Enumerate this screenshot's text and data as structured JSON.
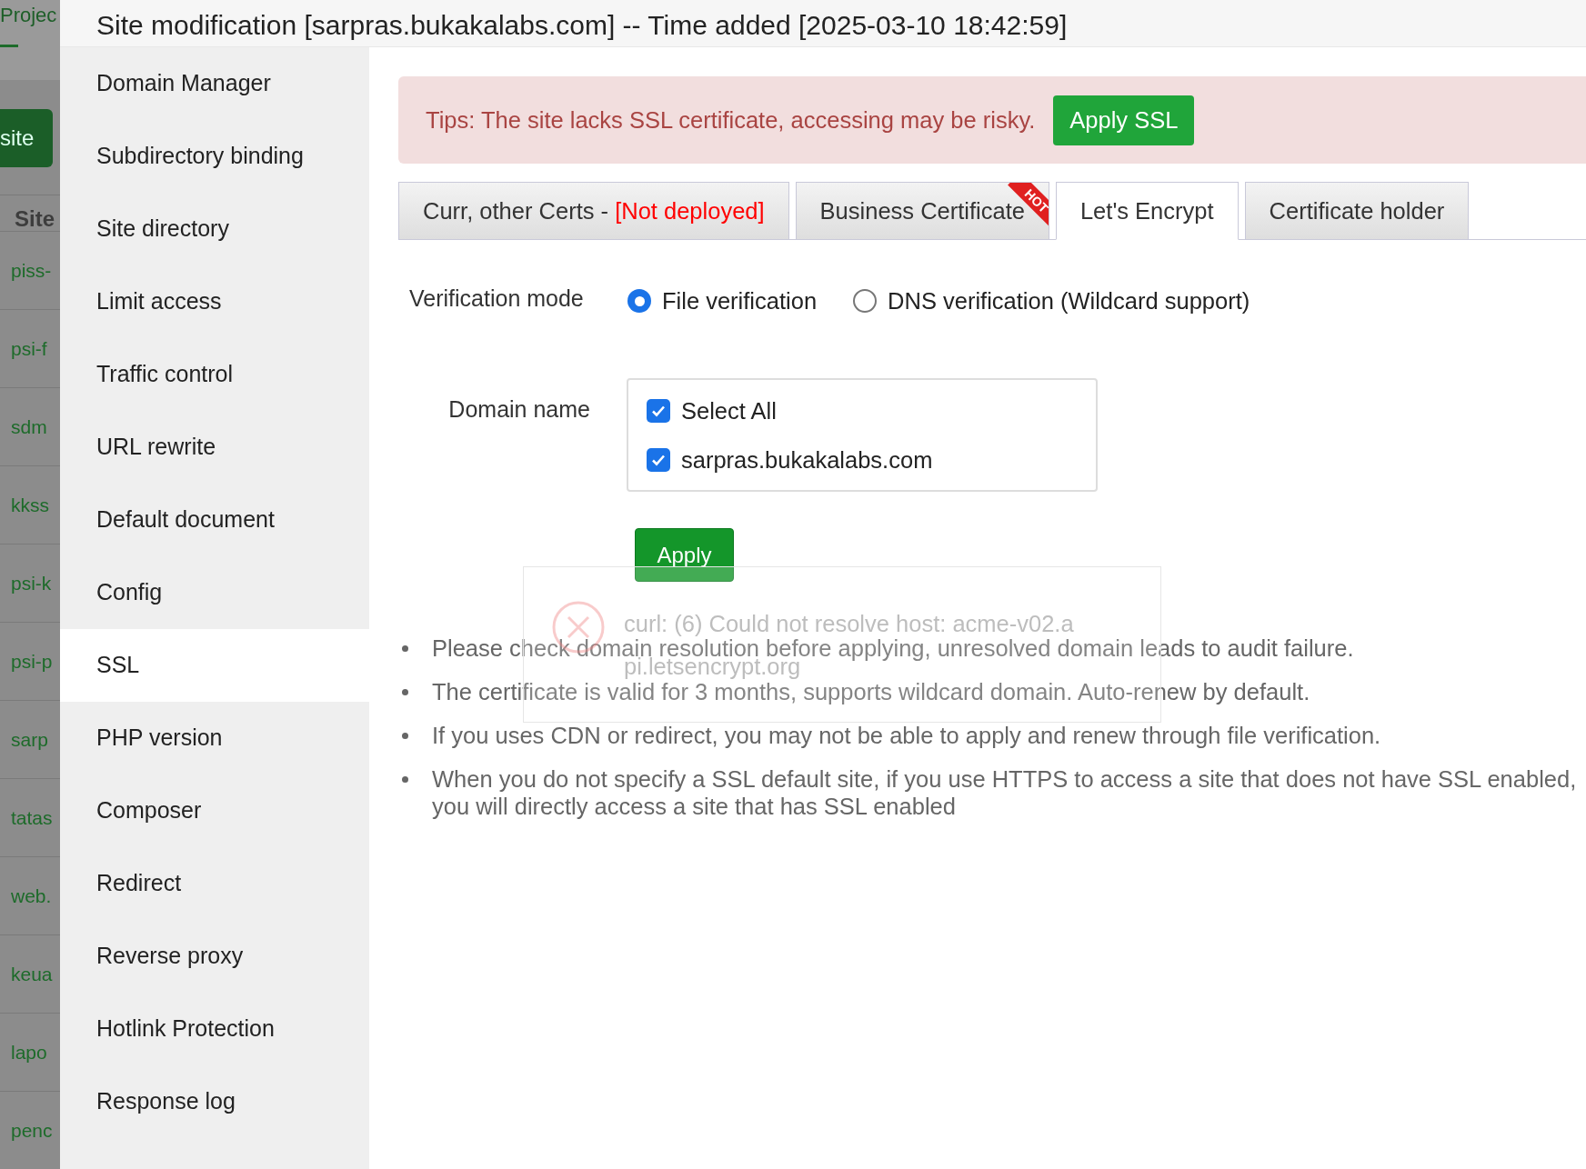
{
  "background_page": {
    "header": "Projec",
    "add_button": "site",
    "column_header": "Site",
    "rows": [
      "piss-",
      "psi-f",
      "sdm",
      "kkss",
      "psi-k",
      "psi-p",
      "sarp",
      "tatas",
      "web.",
      "keua",
      "lapo",
      "penc"
    ]
  },
  "dialog": {
    "title": "Site modification [sarpras.bukakalabs.com] -- Time added [2025-03-10 18:42:59]",
    "menu": [
      {
        "label": "Domain Manager",
        "selected": false
      },
      {
        "label": "Subdirectory binding",
        "selected": false
      },
      {
        "label": "Site directory",
        "selected": false
      },
      {
        "label": "Limit access",
        "selected": false
      },
      {
        "label": "Traffic control",
        "selected": false
      },
      {
        "label": "URL rewrite",
        "selected": false
      },
      {
        "label": "Default document",
        "selected": false
      },
      {
        "label": "Config",
        "selected": false
      },
      {
        "label": "SSL",
        "selected": true
      },
      {
        "label": "PHP version",
        "selected": false
      },
      {
        "label": "Composer",
        "selected": false
      },
      {
        "label": "Redirect",
        "selected": false
      },
      {
        "label": "Reverse proxy",
        "selected": false
      },
      {
        "label": "Hotlink Protection",
        "selected": false
      },
      {
        "label": "Response log",
        "selected": false
      }
    ],
    "alert": {
      "text": "Tips: The site lacks SSL certificate, accessing may be risky.",
      "button": "Apply SSL"
    },
    "tabs": [
      {
        "label": "Curr, other Certs - ",
        "status": "[Not deployed]",
        "selected": false
      },
      {
        "label": "Business Certificate",
        "badge": "HOT",
        "selected": false
      },
      {
        "label": "Let's Encrypt",
        "selected": true
      },
      {
        "label": "Certificate holder",
        "selected": false
      }
    ],
    "verification": {
      "label": "Verification mode",
      "options": [
        {
          "label": "File verification",
          "selected": true
        },
        {
          "label": "DNS verification (Wildcard support)",
          "selected": false
        }
      ]
    },
    "domain": {
      "label": "Domain name",
      "options": [
        {
          "label": "Select All",
          "checked": true
        },
        {
          "label": "sarpras.bukakalabs.com",
          "checked": true
        }
      ]
    },
    "apply_button": "Apply",
    "notes": [
      "Please check domain resolution before applying, unresolved domain leads to audit failure.",
      "The certificate is valid for 3 months, supports wildcard domain. Auto-renew by default.",
      "If you uses CDN or redirect, you may not be able to apply and renew through file verification.",
      "When you do not specify a SSL default site, if you use HTTPS to access a site that does not have SSL enabled, you will directly access a site that has SSL enabled"
    ],
    "toast": {
      "message_lines": [
        "curl: (6) Could not resolve host: acme-v02.a",
        "pi.letsencrypt.org"
      ]
    }
  }
}
